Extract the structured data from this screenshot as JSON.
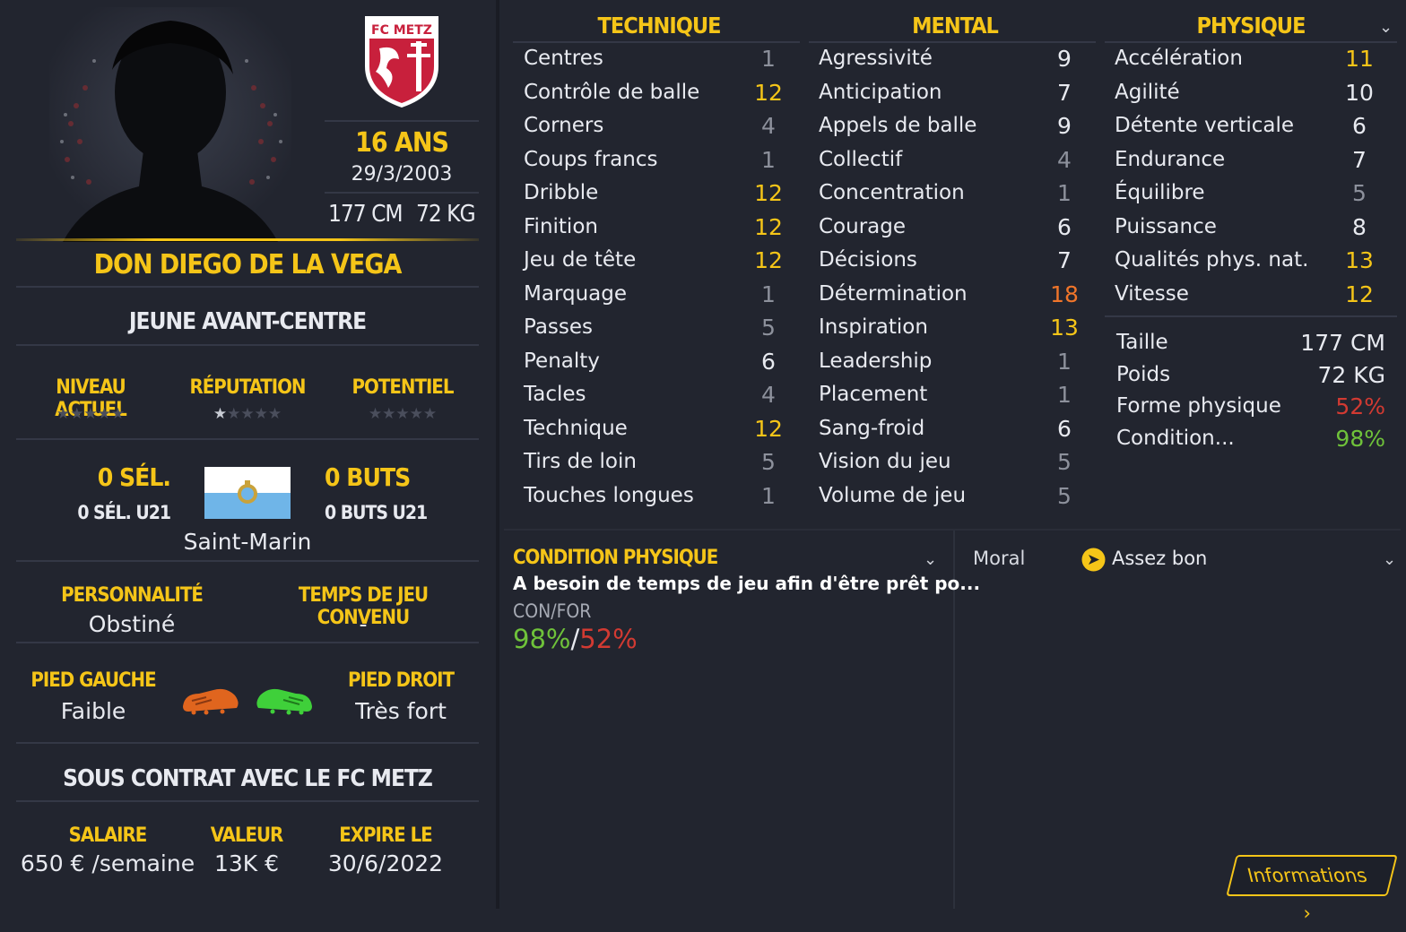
{
  "club": {
    "name": "FC METZ"
  },
  "player": {
    "name": "DON DIEGO DE LA VEGA",
    "age": "16 ANS",
    "dob": "29/3/2003",
    "height": "177 CM",
    "weight": "72 KG",
    "role": "JEUNE AVANT-CENTRE"
  },
  "ratings": {
    "current_label": "NIVEAU ACTUEL",
    "current_stars": 0,
    "reputation_label": "RÉPUTATION",
    "reputation_stars": 0.5,
    "potential_label": "POTENTIEL",
    "potential_stars": 0
  },
  "international": {
    "caps": "0 SÉL.",
    "caps_u21": "0 SÉL. U21",
    "goals": "0 BUTS",
    "goals_u21": "0 BUTS U21",
    "nation": "Saint-Marin",
    "flag_colors": [
      "#ffffff",
      "#6fb5e8"
    ]
  },
  "personality": {
    "label": "PERSONNALITÉ",
    "value": "Obstiné"
  },
  "playtime": {
    "label": "TEMPS DE JEU CONVENU",
    "value": "-"
  },
  "feet": {
    "left_label": "PIED GAUCHE",
    "left_value": "Faible",
    "left_color": "#e0651e",
    "right_label": "PIED DROIT",
    "right_value": "Très fort",
    "right_color": "#3fd03a"
  },
  "contract": {
    "title": "SOUS CONTRAT AVEC LE FC METZ",
    "salary_label": "SALAIRE",
    "salary": "650 € /semaine",
    "value_label": "VALEUR",
    "value": "13K €",
    "expires_label": "EXPIRE LE",
    "expires": "30/6/2022"
  },
  "attributes": {
    "technique_title": "TECHNIQUE",
    "mental_title": "MENTAL",
    "physique_title": "PHYSIQUE",
    "technique": [
      {
        "name": "Centres",
        "value": "1",
        "tier": "grey"
      },
      {
        "name": "Contrôle de balle",
        "value": "12",
        "tier": "yellow"
      },
      {
        "name": "Corners",
        "value": "4",
        "tier": "grey"
      },
      {
        "name": "Coups francs",
        "value": "1",
        "tier": "grey"
      },
      {
        "name": "Dribble",
        "value": "12",
        "tier": "yellow"
      },
      {
        "name": "Finition",
        "value": "12",
        "tier": "yellow"
      },
      {
        "name": "Jeu de tête",
        "value": "12",
        "tier": "yellow"
      },
      {
        "name": "Marquage",
        "value": "1",
        "tier": "grey"
      },
      {
        "name": "Passes",
        "value": "5",
        "tier": "grey"
      },
      {
        "name": "Penalty",
        "value": "6",
        "tier": "white"
      },
      {
        "name": "Tacles",
        "value": "4",
        "tier": "grey"
      },
      {
        "name": "Technique",
        "value": "12",
        "tier": "yellow"
      },
      {
        "name": "Tirs de loin",
        "value": "5",
        "tier": "grey"
      },
      {
        "name": "Touches longues",
        "value": "1",
        "tier": "grey"
      }
    ],
    "mental": [
      {
        "name": "Agressivité",
        "value": "9",
        "tier": "white"
      },
      {
        "name": "Anticipation",
        "value": "7",
        "tier": "white"
      },
      {
        "name": "Appels de balle",
        "value": "9",
        "tier": "white"
      },
      {
        "name": "Collectif",
        "value": "4",
        "tier": "grey"
      },
      {
        "name": "Concentration",
        "value": "1",
        "tier": "grey"
      },
      {
        "name": "Courage",
        "value": "6",
        "tier": "white"
      },
      {
        "name": "Décisions",
        "value": "7",
        "tier": "white"
      },
      {
        "name": "Détermination",
        "value": "18",
        "tier": "orange"
      },
      {
        "name": "Inspiration",
        "value": "13",
        "tier": "yellow"
      },
      {
        "name": "Leadership",
        "value": "1",
        "tier": "grey"
      },
      {
        "name": "Placement",
        "value": "1",
        "tier": "grey"
      },
      {
        "name": "Sang-froid",
        "value": "6",
        "tier": "white"
      },
      {
        "name": "Vision du jeu",
        "value": "5",
        "tier": "grey"
      },
      {
        "name": "Volume de jeu",
        "value": "5",
        "tier": "grey"
      }
    ],
    "physique": [
      {
        "name": "Accélération",
        "value": "11",
        "tier": "yellow"
      },
      {
        "name": "Agilité",
        "value": "10",
        "tier": "white"
      },
      {
        "name": "Détente verticale",
        "value": "6",
        "tier": "white"
      },
      {
        "name": "Endurance",
        "value": "7",
        "tier": "white"
      },
      {
        "name": "Équilibre",
        "value": "5",
        "tier": "grey"
      },
      {
        "name": "Puissance",
        "value": "8",
        "tier": "white"
      },
      {
        "name": "Qualités phys. nat.",
        "value": "13",
        "tier": "yellow"
      },
      {
        "name": "Vitesse",
        "value": "12",
        "tier": "yellow"
      }
    ]
  },
  "body_info": [
    {
      "name": "Taille",
      "value": "177 CM",
      "color": "#e8eaf0"
    },
    {
      "name": "Poids",
      "value": "72 KG",
      "color": "#e8eaf0"
    },
    {
      "name": "Forme physique",
      "value": "52%",
      "color": "#d23a32"
    },
    {
      "name": "Condition...",
      "value": "98%",
      "color": "#6fc23a"
    }
  ],
  "condition": {
    "title": "CONDITION PHYSIQUE",
    "desc": "A besoin de temps de jeu afin d'être prêt po...",
    "confor_label": "CON/FOR",
    "con": "98%",
    "sep": "/",
    "for": "52%"
  },
  "morale": {
    "label": "Moral",
    "value": "Assez bon"
  },
  "buttons": {
    "info": "Informations"
  }
}
